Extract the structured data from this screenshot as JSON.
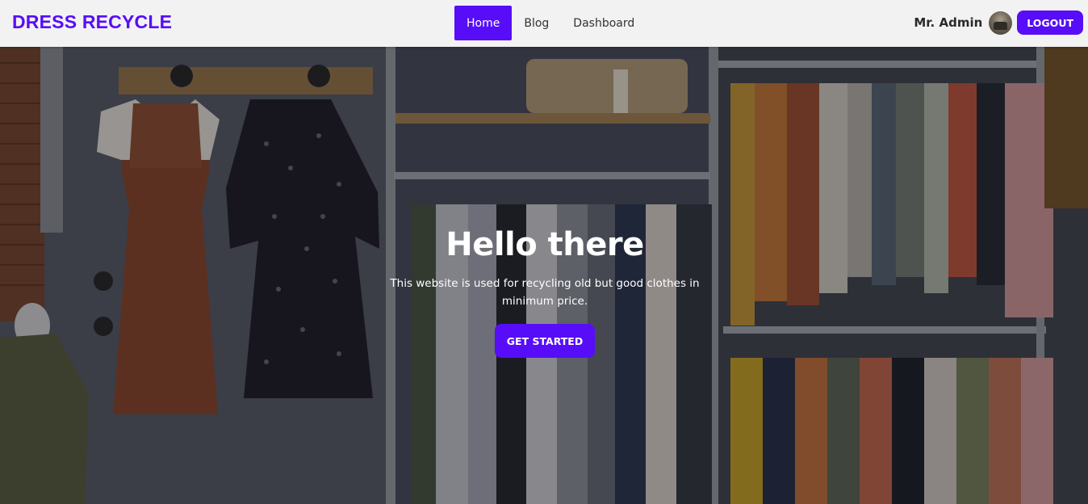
{
  "brand": {
    "name": "DRESS RECYCLE",
    "color": "#570df8"
  },
  "nav": {
    "items": [
      {
        "label": "Home",
        "active": true
      },
      {
        "label": "Blog",
        "active": false
      },
      {
        "label": "Dashboard",
        "active": false
      }
    ]
  },
  "user": {
    "name": "Mr. Admin",
    "avatar": "avatar-image"
  },
  "actions": {
    "logout_label": "LOGOUT"
  },
  "hero": {
    "title": "Hello there",
    "description": "This website is used for recycling old but good clothes in minimum price.",
    "cta_label": "GET STARTED",
    "background": "clothing-store-racks-photo"
  },
  "colors": {
    "primary": "#570df8",
    "navbar_bg": "#f2f2f2"
  }
}
